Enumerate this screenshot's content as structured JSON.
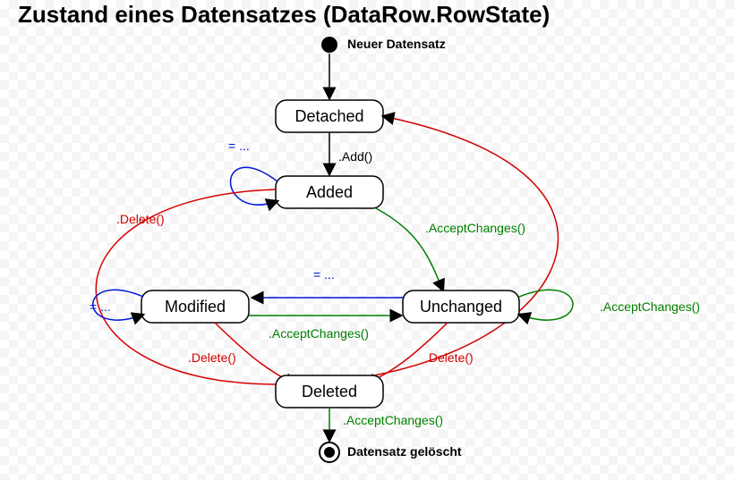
{
  "title": "Zustand eines Datensatzes (DataRow.RowState)",
  "initial": "Neuer Datensatz",
  "final": "Datensatz gelöscht",
  "states": {
    "detached": "Detached",
    "added": "Added",
    "modified": "Modified",
    "unchanged": "Unchanged",
    "deleted": "Deleted"
  },
  "labels": {
    "add": ".Add()",
    "acceptChanges": ".AcceptChanges()",
    "delete": ".Delete()",
    "assign": "= ..."
  }
}
